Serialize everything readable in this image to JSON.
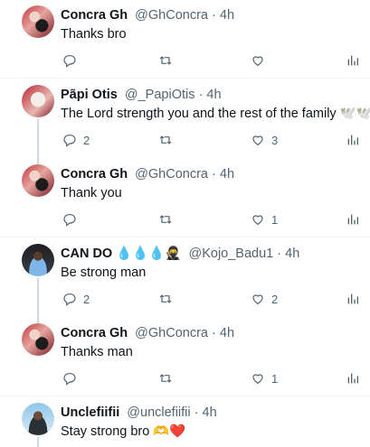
{
  "tweets": [
    {
      "name": "Concra Gh",
      "handle": "@GhConcra",
      "dot": "·",
      "time": "4h",
      "text": "Thanks bro",
      "reply_count": "",
      "retweet_count": "",
      "like_count": "",
      "avatar": "concra"
    },
    {
      "name": "Pa͂pi Otis",
      "handle": "@_PapiOtis",
      "dot": "·",
      "time": "4h",
      "text": "The Lord strength you and the rest of the family 🕊️🕊️",
      "reply_count": "2",
      "retweet_count": "",
      "like_count": "3",
      "avatar": "papi"
    },
    {
      "name": "Concra Gh",
      "handle": "@GhConcra",
      "dot": "·",
      "time": "4h",
      "text": "Thank you",
      "reply_count": "",
      "retweet_count": "",
      "like_count": "1",
      "avatar": "concra"
    },
    {
      "name": "CAN DO 💧💧💧🥷",
      "handle": "@Kojo_Badu1",
      "dot": "·",
      "time": "4h",
      "text": "Be strong man",
      "reply_count": "2",
      "retweet_count": "",
      "like_count": "2",
      "avatar": "cando"
    },
    {
      "name": "Concra Gh",
      "handle": "@GhConcra",
      "dot": "·",
      "time": "4h",
      "text": "Thanks man",
      "reply_count": "",
      "retweet_count": "",
      "like_count": "1",
      "avatar": "concra"
    },
    {
      "name": "Unclefiifii",
      "handle": "@unclefiifii",
      "dot": "·",
      "time": "4h",
      "text": "Stay strong bro 🫶❤️",
      "reply_count": "",
      "retweet_count": "",
      "like_count": "",
      "avatar": "uncle"
    }
  ]
}
